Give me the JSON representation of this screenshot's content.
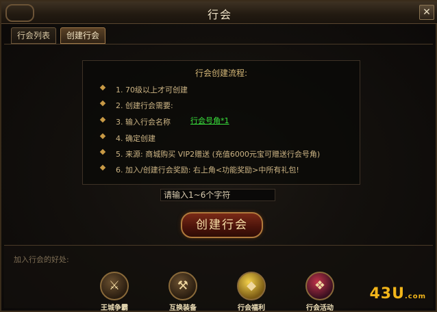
{
  "window": {
    "title": "行会",
    "close_symbol": "✕"
  },
  "tabs": [
    {
      "label": "行会列表",
      "active": false
    },
    {
      "label": "创建行会",
      "active": true
    }
  ],
  "process": {
    "title": "行会创建流程:",
    "steps": [
      "1. 70级以上才可创建",
      "2. 创建行会需要:",
      "3. 输入行会名称",
      "4. 确定创建",
      "5. 来源: 商城购买 VIP2赠送 (充值6000元宝可赠送行会号角)",
      "6. 加入/创建行会奖励: 右上角<功能奖励>中所有礼包!"
    ],
    "item_link": "行会号角*1"
  },
  "name_input": {
    "placeholder": "请输入1~6个字符"
  },
  "create_button": {
    "label": "创建行会"
  },
  "benefits": {
    "title": "加入行会的好处:",
    "items": [
      {
        "label": "王城争霸",
        "icon": "crossed-swords-icon"
      },
      {
        "label": "互换装备",
        "icon": "equipment-icon"
      },
      {
        "label": "行会福利",
        "icon": "gold-ingot-icon"
      },
      {
        "label": "行会活动",
        "icon": "gift-icon"
      }
    ]
  },
  "watermark": {
    "text": "43U",
    "suffix": ".com"
  }
}
